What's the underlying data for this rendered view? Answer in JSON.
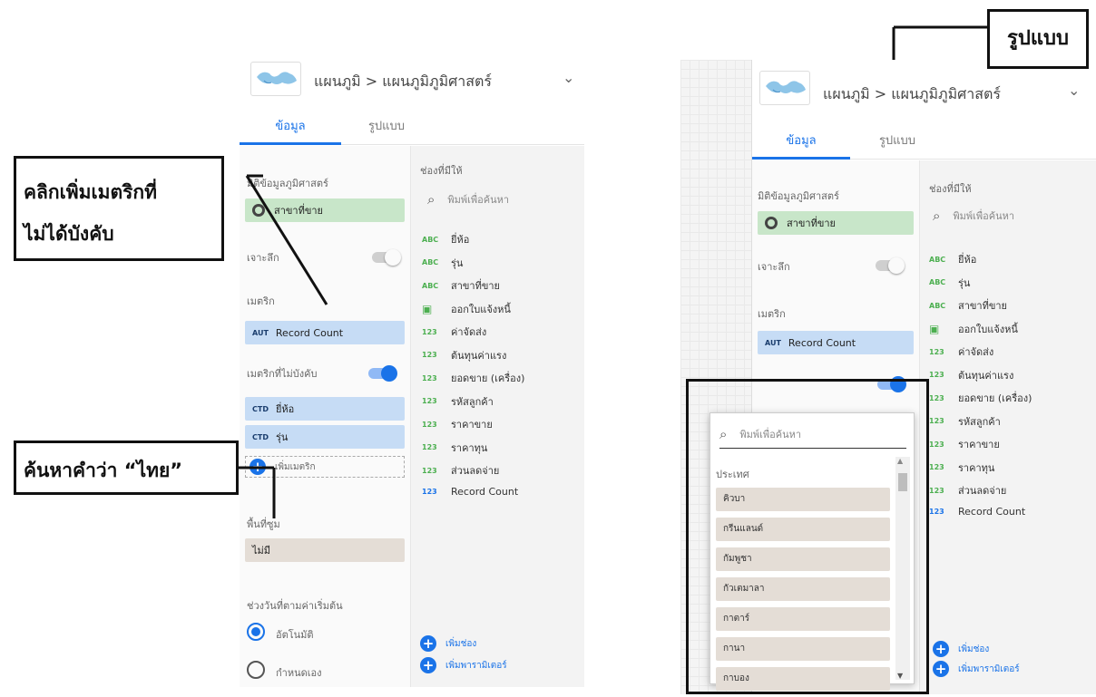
{
  "callouts": {
    "optional_metric": [
      "คลิกเพิ่มเมตริกที่",
      "ไม่ได้บังคับ"
    ],
    "search_thai": "ค้นหาคำว่า “ไทย”",
    "style_tab": "รูปแบบ"
  },
  "panel": {
    "breadcrumb": "แผนภูมิ > แผนภูมิภูมิศาสตร์",
    "tabs": [
      "ข้อมูล",
      "รูปแบบ"
    ],
    "dimension_label": "มิติข้อมูลภูมิศาสตร์",
    "dimension_value": "สาขาที่ขาย",
    "drilldown_label": "เจาะลึก",
    "metric_label": "เมตริก",
    "metric_tag": "AUT",
    "metric_value": "Record Count",
    "optional_metrics_label": "เมตริกที่ไม่บังคับ",
    "optional_metrics": [
      {
        "tag": "CTD",
        "label": "ยี่ห้อ"
      },
      {
        "tag": "CTD",
        "label": "รุ่น"
      }
    ],
    "add_metric": "เพิ่มเมตริก",
    "comparison_label": "พื้นที่ซูม",
    "comparison_value": "ไม่มี",
    "date_range_label": "ช่วงวันที่ตามค่าเริ่มต้น",
    "date_options": [
      "อัตโนมัติ",
      "กำหนดเอง"
    ],
    "available_fields_label": "ช่องที่มีให้",
    "search_placeholder": "พิมพ์เพื่อค้นหา",
    "fields": [
      {
        "type": "ABC",
        "label": "ยี่ห้อ"
      },
      {
        "type": "ABC",
        "label": "รุ่น"
      },
      {
        "type": "ABC",
        "label": "สาขาที่ขาย"
      },
      {
        "type": "cal",
        "label": "ออกใบแจ้งหนี้"
      },
      {
        "type": "123",
        "label": "ค่าจัดส่ง"
      },
      {
        "type": "123",
        "label": "ต้นทุนค่าแรง"
      },
      {
        "type": "123",
        "label": "ยอดขาย (เครื่อง)"
      },
      {
        "type": "123",
        "label": "รหัสลูกค้า"
      },
      {
        "type": "123",
        "label": "ราคาขาย"
      },
      {
        "type": "123",
        "label": "ราคาทุน"
      },
      {
        "type": "123",
        "label": "ส่วนลดจ่าย"
      },
      {
        "type": "123b",
        "label": "Record Count"
      }
    ],
    "add_field": "เพิ่มช่อง",
    "add_parameter": "เพิ่มพารามิเตอร์"
  },
  "dropdown": {
    "search_placeholder": "พิมพ์เพื่อค้นหา",
    "group_label": "ประเทศ",
    "options": [
      "คิวบา",
      "กรีนแลนด์",
      "กัมพูชา",
      "กัวเตมาลา",
      "กาตาร์",
      "กานา",
      "กาบอง"
    ]
  },
  "colors": {
    "accent": "#1a73e8",
    "dimension_chip": "#c8e6c9",
    "metric_chip": "#c6dcf5",
    "neutral_chip": "#e4ddd6"
  },
  "icons": [
    "map-thumbnail-icon",
    "chevron-down-icon",
    "globe-icon",
    "search-icon",
    "calendar-icon",
    "plus-icon"
  ]
}
